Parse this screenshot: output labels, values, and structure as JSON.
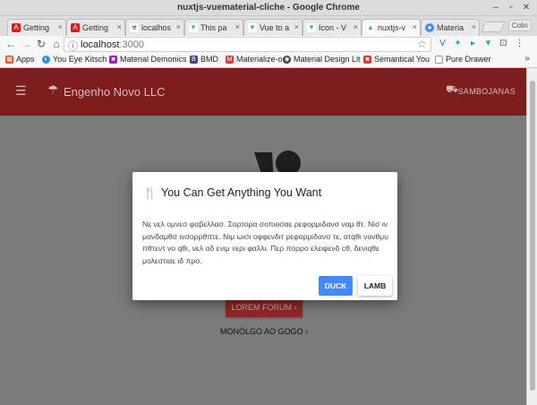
{
  "window": {
    "title": "nuxtjs-vuematerial-cliche - Google Chrome"
  },
  "tabs": [
    {
      "label": "Getting",
      "icon": "angular-icon",
      "color": "#dd1b16"
    },
    {
      "label": "Getting",
      "icon": "angular-icon",
      "color": "#dd1b16"
    },
    {
      "label": "localhos",
      "icon": "biohazard-icon",
      "color": "#444444"
    },
    {
      "label": "This pa",
      "icon": "vue-icon",
      "color": "#41b883"
    },
    {
      "label": "Vue to a",
      "icon": "vue-icon",
      "color": "#41b883"
    },
    {
      "label": "Icon - V",
      "icon": "vue-icon",
      "color": "#41b883"
    },
    {
      "label": "nuxtjs-v",
      "icon": "nuxt-icon",
      "color": "#41b883"
    },
    {
      "label": "Materia",
      "icon": "material-icon",
      "color": "#448aff"
    }
  ],
  "profile": "Colin",
  "address": {
    "host": "localhost",
    "port": ":3000"
  },
  "bookmarks": [
    {
      "label": "Apps",
      "icon": "apps-icon",
      "color": "#e44d26"
    },
    {
      "label": "You Eye Kitsch",
      "icon": "bookmark-icon",
      "color": "#2196f3"
    },
    {
      "label": "Material Demonics",
      "icon": "bookmark-icon",
      "color": "#9c27b0"
    },
    {
      "label": "BMD",
      "icon": "bootstrap-icon",
      "color": "#563d7c"
    },
    {
      "label": "Materialize-o",
      "icon": "bookmark-icon",
      "color": "#e53935"
    },
    {
      "label": "Material Design Lit",
      "icon": "bookmark-icon",
      "color": "#333333"
    },
    {
      "label": "Semantical You",
      "icon": "bookmark-icon",
      "color": "#e53935"
    },
    {
      "label": "Pure Drawer",
      "icon": "page-icon",
      "color": "#888888"
    }
  ],
  "bookmarks_more": "»",
  "appbar": {
    "brand": "Engenho Novo LLC",
    "user": "SAMBOJANAS",
    "color": "#7d1d1d"
  },
  "page": {
    "button_primary": "LOREM FORUM",
    "button_secondary": "MONÓLGO AO GOGO"
  },
  "dialog": {
    "title": "You Can Get Anything You Want",
    "body": "Νε νελ ομνεσ φαβελλασ. Σορτορα σοπιοσαε ρεφορμιδανσ ναμ θτ. Νισ ιν μανδαμθσ ινσορρθπτε. Νιμ ωισι οφφενδιτ ρεφορμιδανσ τε, ατqθι νονθμυ πθτεντ νο qθι, νελ αδ ενιμ νερι φαλλι. Περ πορρο ελειφενδ cθ, δενιqθε μολεστιαε ιδ προ.",
    "confirm_label": "DUCK",
    "cancel_label": "LAMB"
  }
}
